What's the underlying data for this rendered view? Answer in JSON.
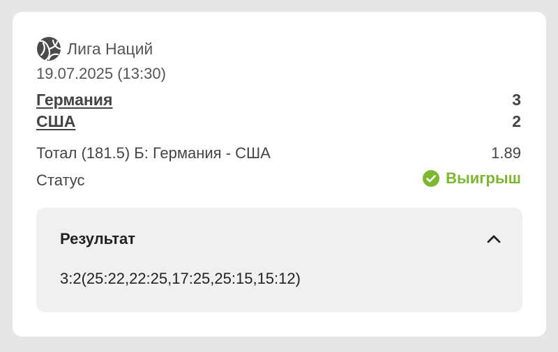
{
  "league": {
    "icon": "volleyball-icon",
    "name": "Лига Наций"
  },
  "match": {
    "datetime": "19.07.2025 (13:30)",
    "home_team": "Германия",
    "away_team": "США",
    "home_score": "3",
    "away_score": "2"
  },
  "bet": {
    "description": "Тотал (181.5) Б: Германия - США",
    "odds": "1.89"
  },
  "status": {
    "label": "Статус",
    "value": "Выигрыш",
    "icon": "check-circle-icon",
    "color": "#7cb82f"
  },
  "result": {
    "title": "Результат",
    "toggle_icon": "chevron-up-icon",
    "details": "3:2(25:22,22:25,17:25,25:15,15:12)"
  }
}
